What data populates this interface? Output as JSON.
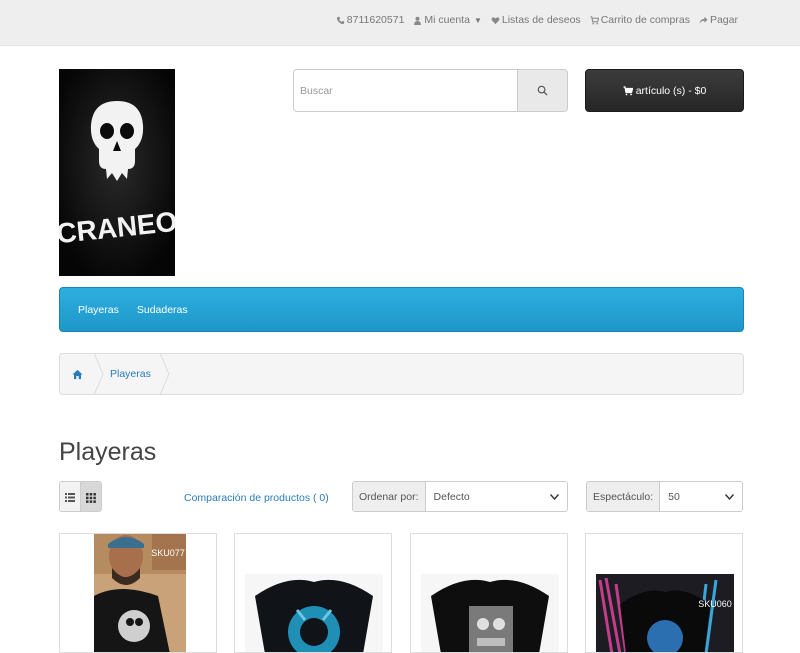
{
  "topbar": {
    "phone": "8711620571",
    "account": "Mi cuenta",
    "wishlist": "Listas de deseos",
    "cart": "Carrito de compras",
    "checkout": "Pagar"
  },
  "logo": {
    "text": "CRANEO"
  },
  "search": {
    "placeholder": "Buscar"
  },
  "cart_button": {
    "label": "artículo (s) - $0"
  },
  "menu": {
    "items": [
      {
        "label": "Playeras"
      },
      {
        "label": "Sudaderas"
      }
    ]
  },
  "breadcrumb": {
    "current": "Playeras"
  },
  "page": {
    "title": "Playeras"
  },
  "toolbar": {
    "compare": "Comparación de productos ( 0)",
    "sort_label": "Ordenar por:",
    "sort_value": "Defecto",
    "limit_label": "Espectáculo:",
    "limit_value": "50"
  },
  "products": [
    {
      "sku": "SKU077"
    },
    {
      "sku": ""
    },
    {
      "sku": ""
    },
    {
      "sku": "SKU060"
    }
  ],
  "colors": {
    "menu": "#23a3d6",
    "link": "#2a7cb8",
    "cart": "#2f2f2f"
  }
}
